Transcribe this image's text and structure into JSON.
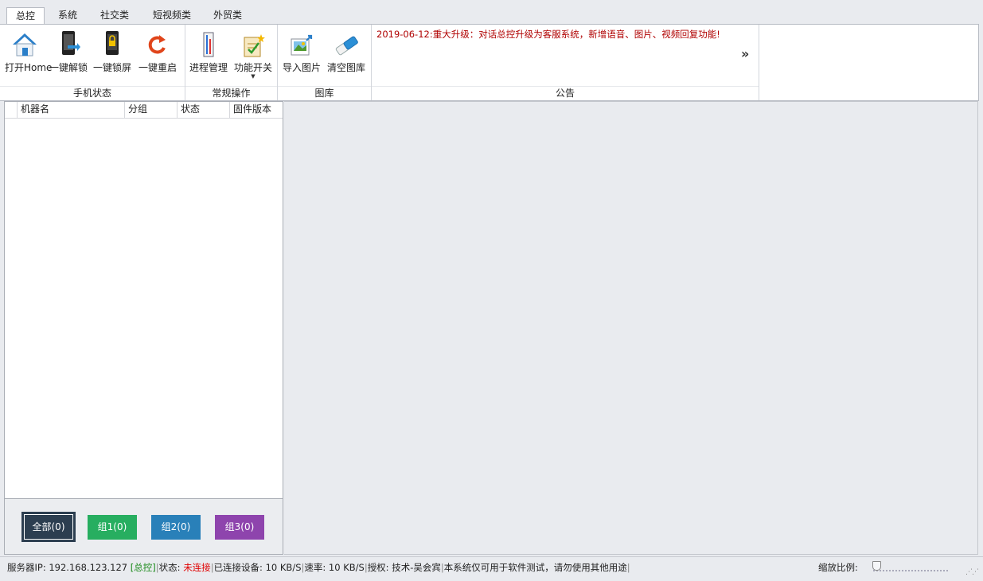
{
  "tabs": [
    {
      "label": "总控",
      "active": true
    },
    {
      "label": "系统",
      "active": false
    },
    {
      "label": "社交类",
      "active": false
    },
    {
      "label": "短视频类",
      "active": false
    },
    {
      "label": "外贸类",
      "active": false
    }
  ],
  "ribbon": {
    "phone_group": {
      "label": "手机状态",
      "buttons": [
        {
          "label": "打开Home",
          "icon": "home-icon"
        },
        {
          "label": "一键解锁",
          "icon": "unlock-phone-icon"
        },
        {
          "label": "一键锁屏",
          "icon": "lock-phone-icon"
        },
        {
          "label": "一键重启",
          "icon": "restart-icon"
        }
      ]
    },
    "ops_group": {
      "label": "常规操作",
      "buttons": [
        {
          "label": "进程管理",
          "icon": "process-icon"
        },
        {
          "label": "功能开关",
          "icon": "feature-switch-icon"
        }
      ]
    },
    "gallery_group": {
      "label": "图库",
      "buttons": [
        {
          "label": "导入图片",
          "icon": "import-image-icon"
        },
        {
          "label": "清空图库",
          "icon": "eraser-icon"
        }
      ]
    },
    "notice_group": {
      "label": "公告",
      "text": "2019-06-12:重大升级：对话总控升级为客服系统，新增语音、图片、视频回复功能!",
      "more": "»"
    }
  },
  "device_table": {
    "columns": [
      "机器名",
      "分组",
      "状态",
      "固件版本"
    ],
    "rows": []
  },
  "group_buttons": [
    {
      "label": "全部(0)",
      "color": "#2c3e50"
    },
    {
      "label": "组1(0)",
      "color": "#27ae60"
    },
    {
      "label": "组2(0)",
      "color": "#2980b9"
    },
    {
      "label": "组3(0)",
      "color": "#8e44ad"
    }
  ],
  "status_bar": {
    "server_ip_label": "服务器IP:",
    "server_ip": "192.168.123.127",
    "mode": "[总控]",
    "state_label": "状态:",
    "state": "未连接",
    "connected_label": "已连接设备:",
    "connected_value": "10 KB/S",
    "speed_label": "速率:",
    "speed_value": "10 KB/S",
    "license_label": "授权:",
    "license_value": "技术-吴会宾",
    "disclaimer": "本系统仅可用于软件测试，请勿使用其他用途",
    "zoom_label": "缩放比例:"
  },
  "colors": {
    "notice_text": "#b00000",
    "mode_text": "#1a8a1a",
    "state_text": "#e00000"
  }
}
